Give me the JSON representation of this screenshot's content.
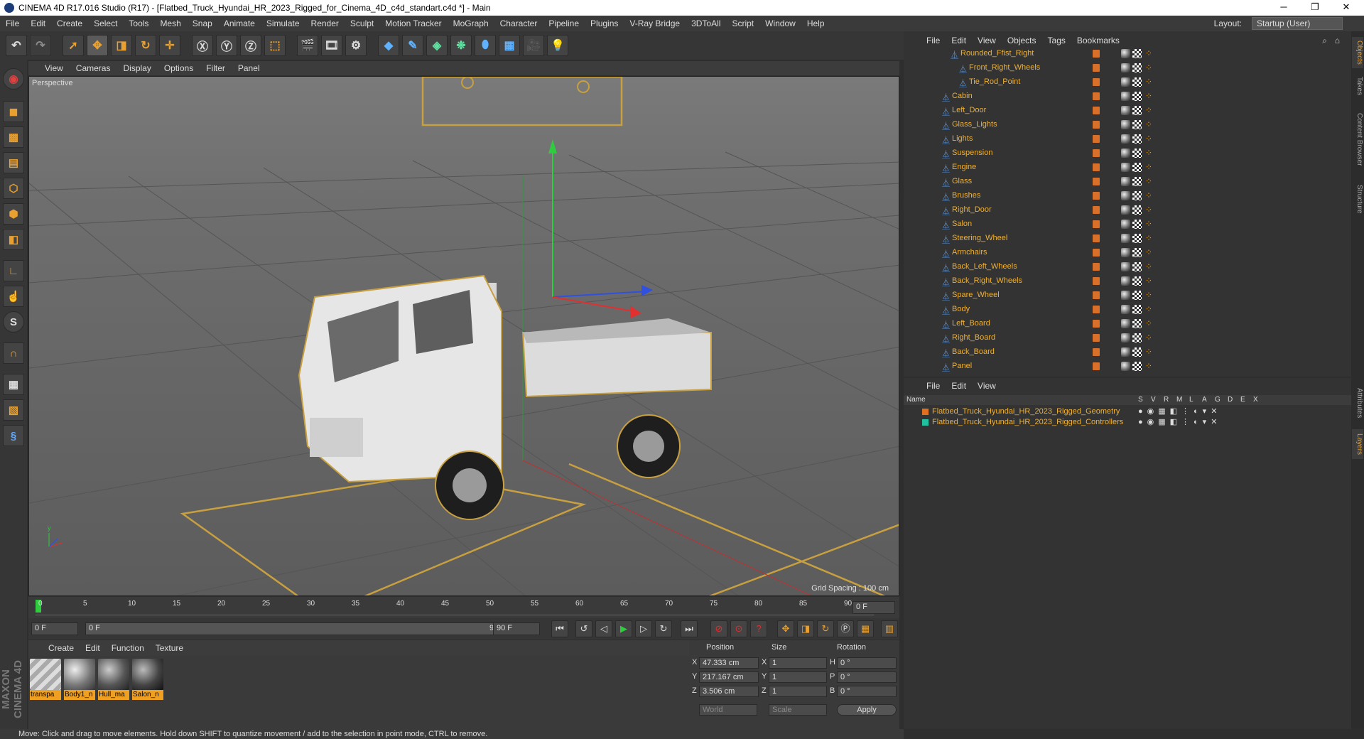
{
  "window": {
    "title": "CINEMA 4D R17.016 Studio (R17) - [Flatbed_Truck_Hyundai_HR_2023_Rigged_for_Cinema_4D_c4d_standart.c4d *] - Main",
    "minimize": "─",
    "maximize": "❐",
    "close": "✕"
  },
  "menubar": [
    "File",
    "Edit",
    "Create",
    "Select",
    "Tools",
    "Mesh",
    "Snap",
    "Animate",
    "Simulate",
    "Render",
    "Sculpt",
    "Motion Tracker",
    "MoGraph",
    "Character",
    "Pipeline",
    "Plugins",
    "V-Ray Bridge",
    "3DToAll",
    "Script",
    "Window",
    "Help"
  ],
  "layout": {
    "label": "Layout:",
    "value": "Startup (User)"
  },
  "viewport": {
    "menu": [
      "View",
      "Cameras",
      "Display",
      "Options",
      "Filter",
      "Panel"
    ],
    "label": "Perspective",
    "grid_spacing": "Grid Spacing : 100 cm"
  },
  "timeline": {
    "ticks": [
      "0",
      "5",
      "10",
      "15",
      "20",
      "25",
      "30",
      "35",
      "40",
      "45",
      "50",
      "55",
      "60",
      "65",
      "70",
      "75",
      "80",
      "85",
      "90"
    ],
    "current_frame": "0 F",
    "start_field": "0 F",
    "range_start": "0 F",
    "range_end": "90 F",
    "end_field": "90 F"
  },
  "material_manager": {
    "menu": [
      "Create",
      "Edit",
      "Function",
      "Texture"
    ],
    "materials": [
      "transpa",
      "Body1_n",
      "Hull_ma",
      "Salon_n"
    ]
  },
  "attributes": {
    "headers": [
      "Position",
      "Size",
      "Rotation"
    ],
    "rows": [
      {
        "axis": "X",
        "pos": "47.333 cm",
        "size_axis": "X",
        "size": "1",
        "rot_axis": "H",
        "rot": "0 °"
      },
      {
        "axis": "Y",
        "pos": "217.167 cm",
        "size_axis": "Y",
        "size": "1",
        "rot_axis": "P",
        "rot": "0 °"
      },
      {
        "axis": "Z",
        "pos": "3.506 cm",
        "size_axis": "Z",
        "size": "1",
        "rot_axis": "B",
        "rot": "0 °"
      }
    ],
    "coord_mode": "World",
    "size_mode": "Scale",
    "apply": "Apply"
  },
  "status": "Move: Click and drag to move elements. Hold down SHIFT to quantize movement / add to the selection in point mode, CTRL to remove.",
  "brand": "MAXON CINEMA 4D",
  "objects": {
    "menu": [
      "File",
      "Edit",
      "View",
      "Objects",
      "Tags",
      "Bookmarks"
    ],
    "items": [
      {
        "name": "Rounded_Ffist_Right"
      },
      {
        "name": "Front_Right_Wheels"
      },
      {
        "name": "Tie_Rod_Point"
      },
      {
        "name": "Cabin"
      },
      {
        "name": "Left_Door"
      },
      {
        "name": "Glass_Lights"
      },
      {
        "name": "Lights"
      },
      {
        "name": "Suspension"
      },
      {
        "name": "Engine"
      },
      {
        "name": "Glass"
      },
      {
        "name": "Brushes"
      },
      {
        "name": "Right_Door"
      },
      {
        "name": "Salon"
      },
      {
        "name": "Steering_Wheel"
      },
      {
        "name": "Armchairs"
      },
      {
        "name": "Back_Left_Wheels"
      },
      {
        "name": "Back_Right_Wheels"
      },
      {
        "name": "Spare_Wheel"
      },
      {
        "name": "Body"
      },
      {
        "name": "Left_Board"
      },
      {
        "name": "Right_Board"
      },
      {
        "name": "Back_Board"
      },
      {
        "name": "Panel"
      }
    ]
  },
  "layers": {
    "menu": [
      "File",
      "Edit",
      "View"
    ],
    "header": {
      "name": "Name",
      "cols": [
        "S",
        "V",
        "R",
        "M",
        "L",
        "A",
        "G",
        "D",
        "E",
        "X"
      ]
    },
    "items": [
      {
        "name": "Flatbed_Truck_Hyundai_HR_2023_Rigged_Geometry",
        "color": "#e07020"
      },
      {
        "name": "Flatbed_Truck_Hyundai_HR_2023_Rigged_Controllers",
        "color": "#20c0a0"
      }
    ]
  },
  "side_tabs": [
    "Objects",
    "Takes",
    "Content Browser",
    "Structure",
    "Attributes",
    "Layers"
  ],
  "colors": {
    "accent": "#f0a020",
    "object_text": "#f0b030",
    "selection": "#e8a030"
  }
}
